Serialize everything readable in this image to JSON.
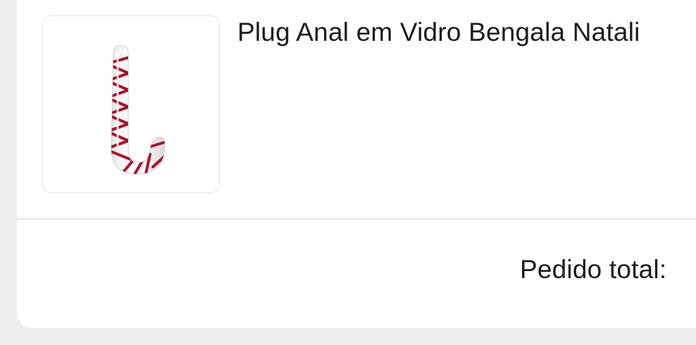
{
  "product": {
    "title": "Plug Anal em Vidro Bengala Natali",
    "image_icon": "candy-cane-icon",
    "stripe_color": "#b0102a",
    "glass_color": "#ffffff"
  },
  "summary": {
    "total_label": "Pedido total:"
  },
  "colors": {
    "page_background": "#efefef",
    "card_background": "#ffffff",
    "divider": "#e6e6e6",
    "text": "#1c1c1c"
  }
}
